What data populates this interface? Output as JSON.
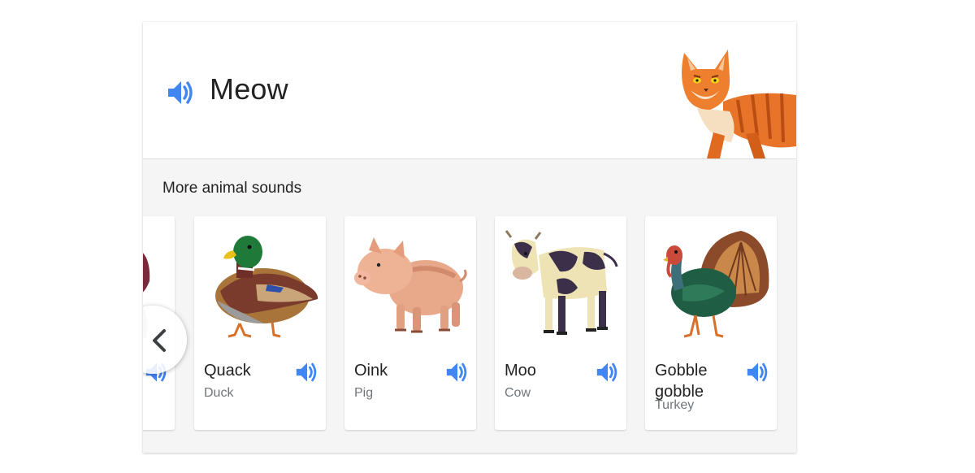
{
  "main": {
    "sound": "Meow",
    "icon": "speaker-icon",
    "accent_color": "#4285f4"
  },
  "more": {
    "heading": "More animal sounds",
    "prev_icon": "chevron-left-icon",
    "animals": [
      {
        "sound": "Quack",
        "name": "Duck",
        "icon": "duck-icon"
      },
      {
        "sound": "Oink",
        "name": "Pig",
        "icon": "pig-icon"
      },
      {
        "sound": "Moo",
        "name": "Cow",
        "icon": "cow-icon"
      },
      {
        "sound": "Gobble gobble",
        "name": "Turkey",
        "icon": "turkey-icon"
      }
    ]
  }
}
